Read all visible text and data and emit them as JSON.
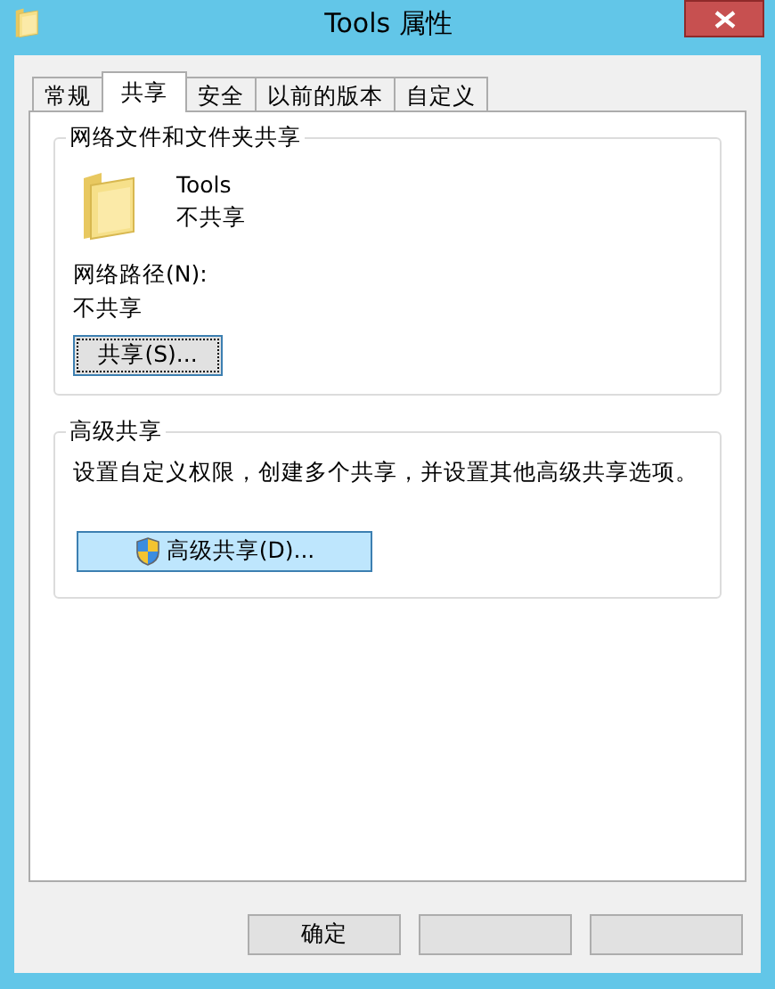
{
  "window": {
    "title": "Tools 属性"
  },
  "tabs": [
    {
      "label": "常规",
      "selected": false
    },
    {
      "label": "共享",
      "selected": true
    },
    {
      "label": "安全",
      "selected": false
    },
    {
      "label": "以前的版本",
      "selected": false
    },
    {
      "label": "自定义",
      "selected": false
    }
  ],
  "network_sharing": {
    "title": "网络文件和文件夹共享",
    "folder_name": "Tools",
    "folder_status": "不共享",
    "path_label": "网络路径(N):",
    "path_value": "不共享",
    "button": "共享(S)..."
  },
  "advanced_sharing": {
    "title": "高级共享",
    "description": "设置自定义权限，创建多个共享，并设置其他高级共享选项。",
    "button": "高级共享(D)..."
  },
  "buttons": [
    {
      "kind": "labeled",
      "label": "确定"
    },
    {
      "kind": "blank"
    },
    {
      "kind": "blank"
    }
  ]
}
